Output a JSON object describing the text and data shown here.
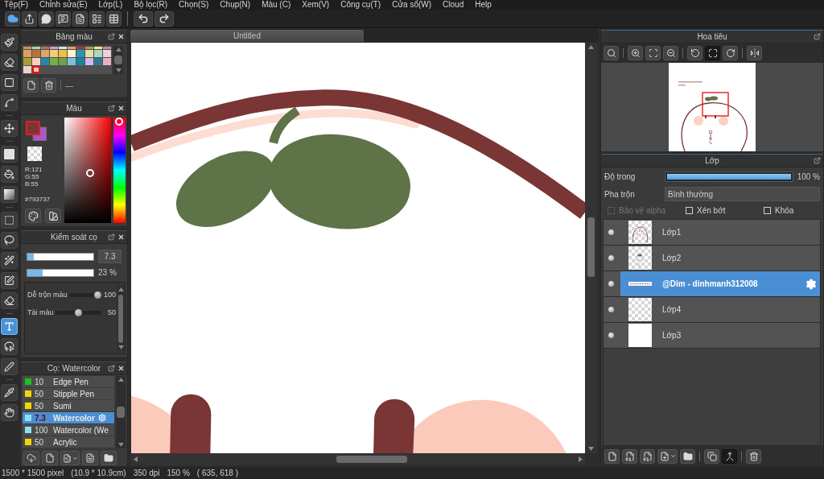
{
  "menu": [
    "Tệp(F)",
    "Chỉnh sửa(E)",
    "Lớp(L)",
    "Bộ lọc(R)",
    "Chọn(S)",
    "Chụp(N)",
    "Màu (C)",
    "Xem(V)",
    "Công cụ(T)",
    "Cửa sổ(W)",
    "Cloud",
    "Help"
  ],
  "tool_groups": [
    [
      {
        "kind": "brush",
        "selected": false
      },
      {
        "kind": "eraser",
        "selected": false
      },
      {
        "kind": "dot",
        "selected": false
      },
      {
        "kind": "scatter",
        "selected": false
      }
    ],
    [
      {
        "kind": "move",
        "selected": false
      }
    ],
    [
      {
        "kind": "fill",
        "selected": false
      },
      {
        "kind": "bucket",
        "selected": false
      },
      {
        "kind": "gradient",
        "selected": false
      }
    ],
    [
      {
        "kind": "select",
        "selected": false
      },
      {
        "kind": "lasso",
        "selected": false
      },
      {
        "kind": "wand",
        "selected": false
      },
      {
        "kind": "selectpen",
        "selected": false
      },
      {
        "kind": "selecteraser",
        "selected": false
      }
    ],
    [
      {
        "kind": "text",
        "selected": true
      },
      {
        "kind": "operation",
        "selected": false
      },
      {
        "kind": "divide",
        "selected": false
      }
    ],
    [
      {
        "kind": "eyedropper",
        "selected": false
      },
      {
        "kind": "hand",
        "selected": false
      }
    ]
  ],
  "palette": {
    "title": "Bảng màu",
    "rows": [
      [
        {
          "color": "#c9906a",
          "selected": false
        },
        {
          "color": "#a8d8a0",
          "selected": false
        },
        {
          "color": "#b86a6a",
          "selected": false
        },
        {
          "color": "#d89ad0",
          "selected": false
        },
        {
          "color": "#c8e4e8",
          "selected": false
        },
        {
          "color": "#e8a060",
          "selected": false
        },
        {
          "color": "#a8304a",
          "selected": false
        },
        {
          "color": "#a0a050",
          "selected": false
        },
        {
          "color": "#e8e890",
          "selected": false
        },
        {
          "color": "#c88888",
          "selected": false
        }
      ],
      [
        {
          "color": "#e0a060",
          "selected": false
        },
        {
          "color": "#b87040",
          "selected": false
        },
        {
          "color": "#d8a868",
          "selected": false
        },
        {
          "color": "#f0d070",
          "selected": false
        },
        {
          "color": "#f0c040",
          "selected": false
        },
        {
          "color": "#fff0d0",
          "selected": false
        },
        {
          "color": "#2898b0",
          "selected": false
        },
        {
          "color": "#e8e0a0",
          "selected": false
        },
        {
          "color": "#a8d8c0",
          "selected": false
        },
        {
          "color": "#f0d0e0",
          "selected": false
        }
      ],
      [
        {
          "color": "#a8a030",
          "selected": false
        },
        {
          "color": "#f8d0c0",
          "selected": false
        },
        {
          "color": "#2888a8",
          "selected": false
        },
        {
          "color": "#78b048",
          "selected": false
        },
        {
          "color": "#70a050",
          "selected": false
        },
        {
          "color": "#80c0d8",
          "selected": false
        },
        {
          "color": "#2080a0",
          "selected": false
        },
        {
          "color": "#d0b8f0",
          "selected": false
        },
        {
          "color": "#307890",
          "selected": false
        },
        {
          "color": "#e8b0c8",
          "selected": false
        }
      ],
      [
        {
          "color": "#f0d0c8",
          "selected": false
        },
        {
          "color": "#fccab8",
          "selected": true
        }
      ]
    ],
    "label": "---"
  },
  "color_panel": {
    "title": "Màu",
    "foreground": {
      "color": "#793737",
      "selected": true
    },
    "background": {
      "color": "#a65ac4",
      "selected": false
    },
    "red": "R:121",
    "green": "G:55",
    "blue": "B:55",
    "hex": "#793737"
  },
  "brush_control": {
    "title": "Kiểm soát cọ",
    "size": {
      "level": 0.1,
      "value": "7.3"
    },
    "opacity": {
      "level": 0.23,
      "value": "23 %"
    },
    "sliders": [
      {
        "label": "Dễ trộn màu",
        "level": 1,
        "value": "100"
      },
      {
        "label": "Tài màu",
        "level": 0.5,
        "value": "50"
      }
    ]
  },
  "brush_list": {
    "title": "Cọ: Watercolor",
    "brushes": [
      {
        "color": "#1fbf1f",
        "size": "10",
        "name": "Edge Pen",
        "selected": false
      },
      {
        "color": "#f2d600",
        "size": "50",
        "name": "Stipple Pen",
        "selected": false
      },
      {
        "color": "#f2d600",
        "size": "50",
        "name": "Sumi",
        "selected": false
      },
      {
        "color": "#8fe0f0",
        "size": "7.3",
        "name": "Watercolor",
        "selected": true
      },
      {
        "color": "#8fe0f0",
        "size": "100",
        "name": "Watercolor (We",
        "selected": false
      },
      {
        "color": "#f2d600",
        "size": "50",
        "name": "Acrylic",
        "selected": false
      }
    ]
  },
  "document": {
    "tab": "Untitled"
  },
  "navigator": {
    "title": "Hoa tiêu",
    "button_groups": [
      [
        {
          "kind": "actual",
          "selected": false
        }
      ],
      [
        {
          "kind": "zoomin",
          "selected": false
        },
        {
          "kind": "fit",
          "selected": false
        },
        {
          "kind": "zoomout",
          "selected": false
        }
      ],
      [
        {
          "kind": "rotleft",
          "selected": false
        },
        {
          "kind": "fitscreen",
          "selected": true
        },
        {
          "kind": "rotright",
          "selected": false
        }
      ],
      [
        {
          "kind": "flip",
          "selected": false
        }
      ]
    ]
  },
  "layers": {
    "title": "Lớp",
    "opacity_label": "Độ trong",
    "opacity": {
      "level": 1,
      "value": "100 %"
    },
    "blend_label": "Pha trộn",
    "blend_mode": "Bình thường",
    "options": [
      {
        "label": "Bảo vệ alpha",
        "checked": false,
        "disabled": true
      },
      {
        "label": "Xén bớt",
        "checked": false,
        "disabled": false
      },
      {
        "label": "Khóa",
        "checked": false,
        "disabled": false
      }
    ],
    "items": [
      {
        "name": "Lớp1",
        "kind": "face",
        "selected": false
      },
      {
        "name": "Lớp2",
        "kind": "sprout",
        "selected": false
      },
      {
        "name": "@Dim - dinhmanh312008",
        "kind": "text",
        "selected": true
      },
      {
        "name": "Lớp4",
        "kind": "blank",
        "selected": false
      },
      {
        "name": "Lớp3",
        "kind": "fill",
        "selected": false
      }
    ],
    "button_groups": [
      [
        {
          "kind": "new",
          "selected": false
        },
        {
          "kind": "eight",
          "selected": false
        },
        {
          "kind": "one",
          "selected": false
        },
        {
          "kind": "add",
          "selected": false
        },
        {
          "kind": "folder",
          "selected": false
        }
      ],
      [
        {
          "kind": "copy",
          "selected": false
        },
        {
          "kind": "merge",
          "selected": true
        }
      ],
      [
        {
          "kind": "delete",
          "selected": false
        }
      ]
    ]
  },
  "status_bar": [
    "1500 * 1500 pixel",
    "(10.9 * 10.9cm)",
    "350 dpi",
    "150 %",
    "( 635, 618 )"
  ]
}
